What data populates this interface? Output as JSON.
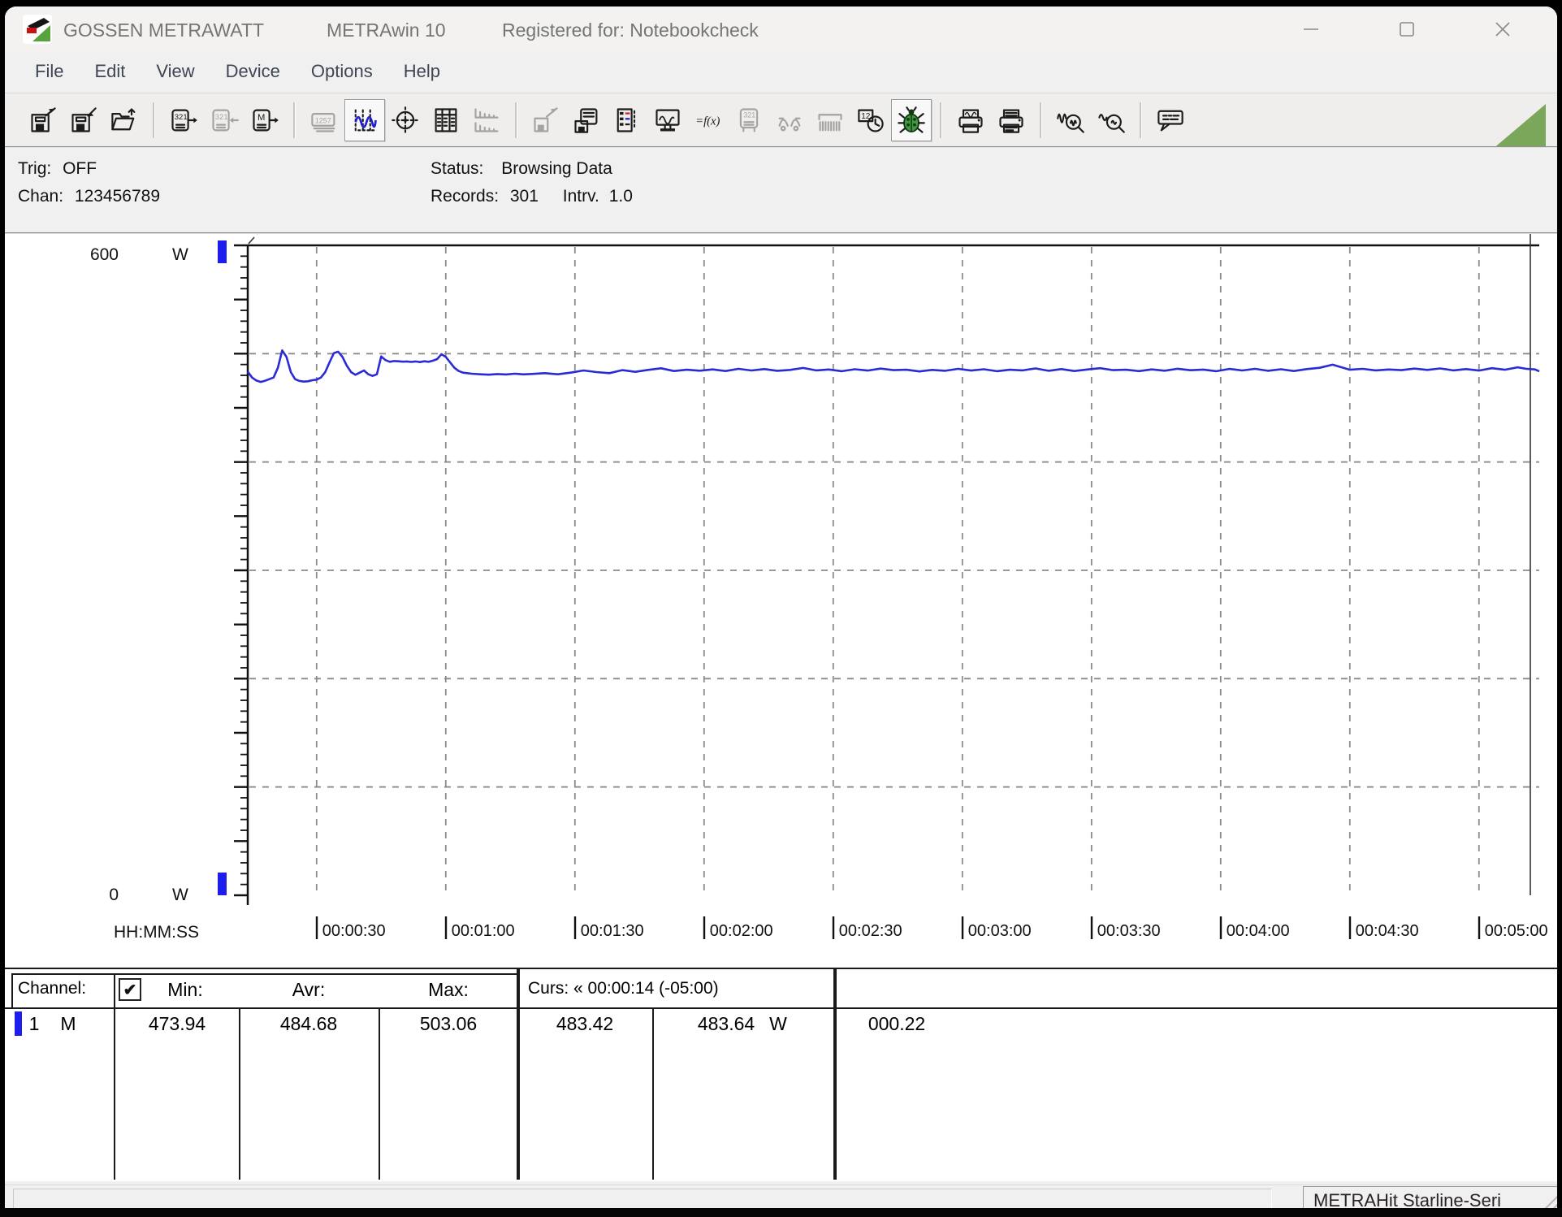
{
  "window": {
    "title_left": "GOSSEN METRAWATT",
    "title_mid": "METRAwin 10",
    "title_right": "Registered for: Notebookcheck"
  },
  "menu": {
    "items": [
      "File",
      "Edit",
      "View",
      "Device",
      "Options",
      "Help"
    ]
  },
  "toolbar": {
    "buttons": [
      {
        "name": "save-export-icon"
      },
      {
        "name": "save-import-icon"
      },
      {
        "name": "open-file-icon"
      },
      {
        "sep": true
      },
      {
        "name": "read-device-321-icon"
      },
      {
        "name": "write-device-321-icon",
        "disabled": true
      },
      {
        "name": "read-memory-icon"
      },
      {
        "sep": true
      },
      {
        "name": "multimeter-display-icon",
        "disabled": true
      },
      {
        "name": "chart-view-icon",
        "pressed": true
      },
      {
        "name": "xy-view-icon"
      },
      {
        "name": "table-view-icon"
      },
      {
        "name": "histogram-view-icon",
        "disabled": true
      },
      {
        "sep": true
      },
      {
        "name": "export-disk-icon",
        "disabled": true
      },
      {
        "name": "device-save-icon"
      },
      {
        "name": "channel-list-icon"
      },
      {
        "name": "online-monitor-icon"
      },
      {
        "name": "function-fx-icon"
      },
      {
        "name": "device-321-gray-icon",
        "disabled": true
      },
      {
        "name": "probes-icon",
        "disabled": true
      },
      {
        "name": "impulse-icon",
        "disabled": true
      },
      {
        "name": "timer-clock-icon"
      },
      {
        "name": "live-bug-icon",
        "pressed": true
      },
      {
        "sep": true
      },
      {
        "name": "print-chart-icon"
      },
      {
        "name": "print-report-icon"
      },
      {
        "sep": true
      },
      {
        "name": "zoom-in-icon"
      },
      {
        "name": "zoom-out-icon"
      },
      {
        "sep": true
      },
      {
        "name": "comment-balloon-icon"
      }
    ]
  },
  "status_panel": {
    "trig_label": "Trig:",
    "trig_value": "OFF",
    "chan_label": "Chan:",
    "chan_value": "123456789",
    "status_label": "Status:",
    "status_value": "Browsing Data",
    "records_label": "Records:",
    "records_value": "301",
    "intrv_label": "Intrv.",
    "intrv_value": "1.0"
  },
  "chart": {
    "y_top_label": "600",
    "y_top_unit": "W",
    "y_bottom_label": "0",
    "y_bottom_unit": "W",
    "x_axis_label": "HH:MM:SS",
    "x_ticks": [
      "00:00:30",
      "00:01:00",
      "00:01:30",
      "00:02:00",
      "00:02:30",
      "00:03:00",
      "00:03:30",
      "00:04:00",
      "00:04:30",
      "00:05:00"
    ]
  },
  "chart_data": {
    "type": "line",
    "title": "Power log channel 1",
    "xlabel": "HH:MM:SS",
    "ylabel": "W",
    "ylim": [
      0,
      600
    ],
    "x_start_s": 14,
    "x_end_s": 314,
    "grid": "on",
    "series_color": "#2b2bd6",
    "stats": {
      "min": 473.94,
      "avr": 484.68,
      "max": 503.06,
      "cursor1": 483.42,
      "cursor2": 483.64,
      "delta": 0.22
    },
    "points": [
      [
        14,
        483.4
      ],
      [
        15,
        478
      ],
      [
        16,
        475.2
      ],
      [
        17,
        473.94
      ],
      [
        18,
        475
      ],
      [
        19,
        476.5
      ],
      [
        20,
        478
      ],
      [
        21,
        487
      ],
      [
        22,
        503.06
      ],
      [
        23,
        497
      ],
      [
        24,
        483
      ],
      [
        25,
        476.5
      ],
      [
        26,
        474.8
      ],
      [
        27,
        474.2
      ],
      [
        28,
        474.5
      ],
      [
        29,
        475.5
      ],
      [
        30,
        476
      ],
      [
        31,
        478
      ],
      [
        32,
        483
      ],
      [
        33,
        492
      ],
      [
        34,
        500.5
      ],
      [
        35,
        501.8
      ],
      [
        36,
        497
      ],
      [
        37,
        489
      ],
      [
        38,
        483
      ],
      [
        39,
        480.5
      ],
      [
        40,
        482.5
      ],
      [
        41,
        484.5
      ],
      [
        42,
        481
      ],
      [
        43,
        479.5
      ],
      [
        44,
        481
      ],
      [
        45,
        497.5
      ],
      [
        46,
        494
      ],
      [
        47,
        492.5
      ],
      [
        48,
        493.2
      ],
      [
        49,
        493
      ],
      [
        50,
        492.6
      ],
      [
        51,
        492.8
      ],
      [
        52,
        492.4
      ],
      [
        53,
        492.8
      ],
      [
        54,
        492.2
      ],
      [
        55,
        493
      ],
      [
        56,
        492.5
      ],
      [
        57,
        493.5
      ],
      [
        58,
        495
      ],
      [
        59,
        499.5
      ],
      [
        60,
        497
      ],
      [
        61,
        492
      ],
      [
        62,
        487
      ],
      [
        63,
        484
      ],
      [
        64,
        482.5
      ],
      [
        66,
        481.5
      ],
      [
        68,
        481
      ],
      [
        70,
        480.6
      ],
      [
        72,
        481.2
      ],
      [
        74,
        480.8
      ],
      [
        76,
        481.5
      ],
      [
        78,
        480.9
      ],
      [
        80,
        481.3
      ],
      [
        83,
        482
      ],
      [
        86,
        481
      ],
      [
        89,
        482.5
      ],
      [
        92,
        484.5
      ],
      [
        95,
        483
      ],
      [
        98,
        482
      ],
      [
        101,
        484.8
      ],
      [
        104,
        483.2
      ],
      [
        107,
        485
      ],
      [
        110,
        486.5
      ],
      [
        113,
        484
      ],
      [
        116,
        485.2
      ],
      [
        119,
        484.3
      ],
      [
        122,
        485.5
      ],
      [
        125,
        484
      ],
      [
        128,
        486
      ],
      [
        131,
        484.5
      ],
      [
        134,
        485.8
      ],
      [
        137,
        484.2
      ],
      [
        140,
        485
      ],
      [
        143,
        486.8
      ],
      [
        146,
        484.6
      ],
      [
        149,
        485.4
      ],
      [
        152,
        483.8
      ],
      [
        155,
        485.6
      ],
      [
        158,
        484.4
      ],
      [
        161,
        486.2
      ],
      [
        164,
        484.8
      ],
      [
        167,
        485.2
      ],
      [
        170,
        483.6
      ],
      [
        173,
        485
      ],
      [
        176,
        484.2
      ],
      [
        179,
        486
      ],
      [
        182,
        484.4
      ],
      [
        185,
        485.6
      ],
      [
        188,
        483.8
      ],
      [
        191,
        485.2
      ],
      [
        194,
        484.6
      ],
      [
        197,
        486.4
      ],
      [
        200,
        484.2
      ],
      [
        203,
        485.8
      ],
      [
        206,
        484
      ],
      [
        209,
        485.4
      ],
      [
        212,
        486.6
      ],
      [
        215,
        484.8
      ],
      [
        218,
        485.2
      ],
      [
        221,
        483.9
      ],
      [
        224,
        485.5
      ],
      [
        227,
        484.3
      ],
      [
        230,
        486.1
      ],
      [
        233,
        484.7
      ],
      [
        236,
        485.3
      ],
      [
        239,
        483.8
      ],
      [
        242,
        485.9
      ],
      [
        245,
        484.5
      ],
      [
        248,
        486
      ],
      [
        251,
        484.2
      ],
      [
        254,
        485.6
      ],
      [
        257,
        484
      ],
      [
        260,
        485.8
      ],
      [
        263,
        487
      ],
      [
        266,
        489.8
      ],
      [
        268,
        487.5
      ],
      [
        270,
        485.2
      ],
      [
        273,
        486
      ],
      [
        276,
        484.6
      ],
      [
        279,
        485.4
      ],
      [
        282,
        484.8
      ],
      [
        285,
        486.2
      ],
      [
        288,
        485
      ],
      [
        291,
        486.4
      ],
      [
        294,
        484.6
      ],
      [
        297,
        485.8
      ],
      [
        300,
        484.4
      ],
      [
        303,
        486.6
      ],
      [
        306,
        485.2
      ],
      [
        309,
        487.4
      ],
      [
        311,
        486
      ],
      [
        313,
        485.5
      ],
      [
        314,
        483.64
      ]
    ]
  },
  "table": {
    "channel_label": "Channel:",
    "checkbox_checked": "✔",
    "min_label": "Min:",
    "avr_label": "Avr:",
    "max_label": "Max:",
    "curs_label": "Curs: « 00:00:14 (-05:00)",
    "row": {
      "ch": "1",
      "mode": "M",
      "min": "473.94",
      "avr": "484.68",
      "max": "503.06",
      "curs1": "483.42",
      "curs2": "483.64",
      "curs2_unit": "W",
      "delta": "000.22"
    }
  },
  "statusbar": {
    "device": "METRAHit Starline-Seri"
  },
  "colors": {
    "accent_blue": "#1d1dee",
    "trace_blue": "#2b2bd6",
    "grid_gray": "#8c8c8c",
    "green_triangle": "#7ba75b"
  }
}
